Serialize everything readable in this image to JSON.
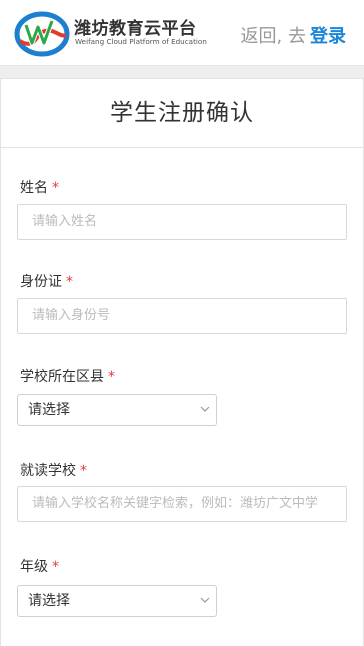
{
  "header": {
    "brand_cn": "潍坊教育云平台",
    "brand_en": "Weifang Cloud Platform of Education",
    "back_label": "返回, 去",
    "login_label": "登录"
  },
  "page": {
    "title": "学生注册确认"
  },
  "form": {
    "name": {
      "label": "姓名",
      "required": "*",
      "placeholder": "请输入姓名"
    },
    "id_card": {
      "label": "身份证",
      "required": "*",
      "placeholder": "请输入身份号"
    },
    "district": {
      "label": "学校所在区县",
      "required": "*",
      "value": "请选择"
    },
    "school": {
      "label": "就读学校",
      "required": "*",
      "placeholder": "请输入学校名称关键字检索，例如：潍坊广文中学"
    },
    "grade": {
      "label": "年级",
      "required": "*",
      "value": "请选择"
    }
  },
  "colors": {
    "accent": "#1a86d9",
    "required": "#e43b3b"
  }
}
